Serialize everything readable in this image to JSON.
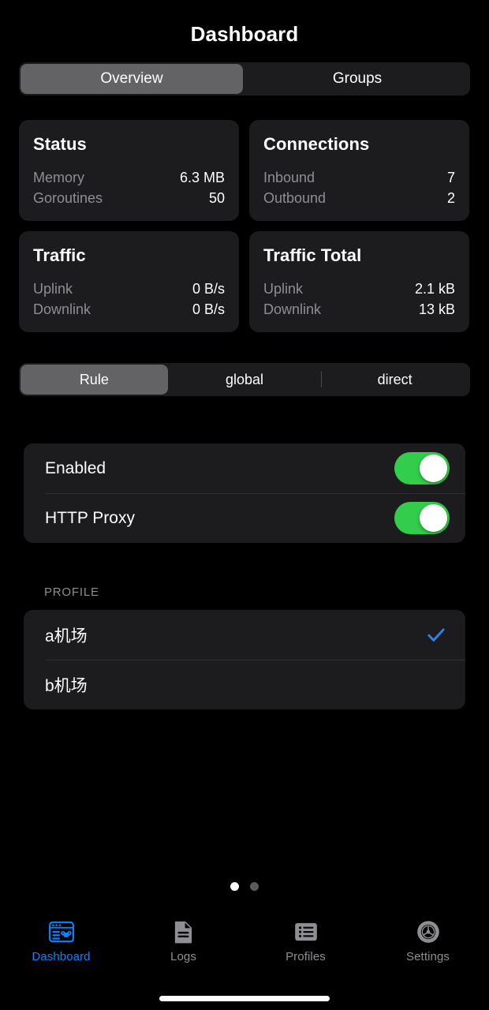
{
  "nav": {
    "title": "Dashboard"
  },
  "top_tabs": {
    "items": [
      {
        "label": "Overview",
        "active": true
      },
      {
        "label": "Groups",
        "active": false
      }
    ]
  },
  "cards": [
    {
      "name": "status",
      "title": "Status",
      "rows": [
        {
          "key": "Memory",
          "value": "6.3 MB"
        },
        {
          "key": "Goroutines",
          "value": "50"
        }
      ]
    },
    {
      "name": "connections",
      "title": "Connections",
      "rows": [
        {
          "key": "Inbound",
          "value": "7"
        },
        {
          "key": "Outbound",
          "value": "2"
        }
      ]
    },
    {
      "name": "traffic",
      "title": "Traffic",
      "rows": [
        {
          "key": "Uplink",
          "value": "0 B/s"
        },
        {
          "key": "Downlink",
          "value": "0 B/s"
        }
      ]
    },
    {
      "name": "traffic-total",
      "title": "Traffic Total",
      "rows": [
        {
          "key": "Uplink",
          "value": "2.1 kB"
        },
        {
          "key": "Downlink",
          "value": "13 kB"
        }
      ]
    }
  ],
  "mode_selector": {
    "items": [
      {
        "label": "Rule",
        "active": true,
        "divider_before": false
      },
      {
        "label": "global",
        "active": false,
        "divider_before": false
      },
      {
        "label": "direct",
        "active": false,
        "divider_before": true
      }
    ]
  },
  "toggles": [
    {
      "label": "Enabled",
      "state": "on"
    },
    {
      "label": "HTTP Proxy",
      "state": "on"
    }
  ],
  "profile": {
    "section_label": "PROFILE",
    "items": [
      {
        "name": "a机场",
        "selected": true
      },
      {
        "name": "b机场",
        "selected": false
      }
    ]
  },
  "page_dots": {
    "count": 2,
    "active_index": 0
  },
  "tabbar": {
    "items": [
      {
        "label": "Dashboard",
        "icon": "dashboard-window-icon",
        "active": true
      },
      {
        "label": "Logs",
        "icon": "document-icon",
        "active": false
      },
      {
        "label": "Profiles",
        "icon": "list-icon",
        "active": false
      },
      {
        "label": "Settings",
        "icon": "gear-icon",
        "active": false
      }
    ]
  },
  "colors": {
    "background": "#000000",
    "card": "#1c1c1e",
    "segment_active": "#636366",
    "accent_blue": "#0a84ff",
    "toggle_green": "#32cd4a",
    "secondary_text": "#8e8e93"
  }
}
